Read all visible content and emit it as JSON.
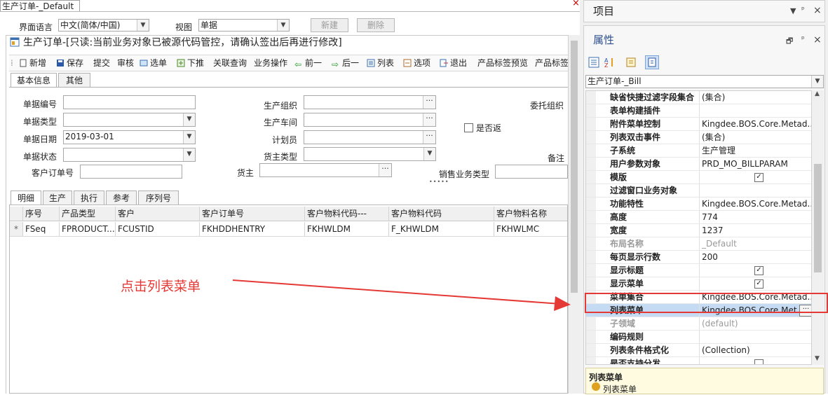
{
  "designer": {
    "doc_tab": "生产订单-_Default",
    "close_glyph": "×",
    "lang_label": "界面语言",
    "lang_value": "中文(简体/中国)",
    "view_label": "视图",
    "view_value": "单据",
    "new_label": "新建",
    "delete_label": "删除",
    "form_title": "生产订单-[只读:当前业务对象已被源代码管控，请确认签出后再进行修改]",
    "toolbar": [
      "新增",
      "保存",
      "提交",
      "审核",
      "选单",
      "下推",
      "关联查询",
      "业务操作",
      "前一",
      "后一",
      "列表",
      "选项",
      "退出",
      "产品标签预览",
      "产品标签"
    ],
    "tabs": [
      "基本信息",
      "其他"
    ],
    "fields": {
      "bill_no": "单据编号",
      "bill_type": "单据类型",
      "bill_date": "单据日期",
      "bill_date_value": "2019-03-01",
      "bill_status": "单据状态",
      "cust_order_no": "客户订单号",
      "prd_org": "生产组织",
      "workshop": "生产车间",
      "planner": "计划员",
      "owner_type": "货主类型",
      "owner": "货主",
      "entrust_org": "委托组织",
      "is_rework": "是否返",
      "remark": "备注",
      "sale_biz_type": "销售业务类型"
    },
    "dots": "•••••",
    "detail_tabs": [
      "明细",
      "生产",
      "执行",
      "参考",
      "序列号"
    ],
    "grid_headers": [
      "序号",
      "产品类型",
      "客户",
      "客户订单号",
      "客户物料代码---",
      "客户物料代码",
      "客户物料名称"
    ],
    "grid_row": [
      "FSeq",
      "FPRODUCT...",
      "FCUSTID",
      "FKHDDHENTRY",
      "FKHWLDM",
      "F_KHWLDM",
      "FKHWLMC"
    ],
    "row_marker": "*",
    "annotation": "点击列表菜单"
  },
  "project_pane": {
    "title": "项目",
    "controls": [
      "▼",
      "ᵖ",
      "×"
    ]
  },
  "property_pane": {
    "title": "属性",
    "controls": [
      "🗗",
      "ᵖ",
      "×"
    ],
    "object": "生产订单-_Bill",
    "rows": [
      {
        "name": "缺省快捷过滤字段集合",
        "value": "(集合)"
      },
      {
        "name": "表单构建插件",
        "value": ""
      },
      {
        "name": "附件菜单控制",
        "value": "Kingdee.BOS.Core.Metad..."
      },
      {
        "name": "列表双击事件",
        "value": "(集合)"
      },
      {
        "name": "子系统",
        "value": "生产管理"
      },
      {
        "name": "用户参数对象",
        "value": "PRD_MO_BILLPARAM"
      },
      {
        "name": "模版",
        "value": "✓"
      },
      {
        "name": "过滤窗口业务对象",
        "value": ""
      },
      {
        "name": "功能特性",
        "value": "Kingdee.BOS.Core.Metad..."
      },
      {
        "name": "高度",
        "value": "774"
      },
      {
        "name": "宽度",
        "value": "1237"
      },
      {
        "name": "布局名称",
        "value": "_Default"
      },
      {
        "name": "每页显示行数",
        "value": "200"
      },
      {
        "name": "显示标题",
        "value": "✓"
      },
      {
        "name": "显示菜单",
        "value": "✓"
      },
      {
        "name": "菜单集合",
        "value": "Kingdee.BOS.Core.Metad..."
      },
      {
        "name": "列表菜单",
        "value": "Kingdee.BOS.Core.Met..."
      },
      {
        "name": "子领域",
        "value": "(default)"
      },
      {
        "name": "编码规则",
        "value": ""
      },
      {
        "name": "列表条件格式化",
        "value": "(Collection)"
      },
      {
        "name": "是否支持分发",
        "value": ""
      }
    ],
    "desc_title": "列表菜单",
    "desc_text": "列表菜单"
  },
  "colors": {
    "highlight": "#e53935",
    "arrow": "#e53935",
    "selected_row": "#c5dbf3",
    "desc_bg": "#fffbe0"
  }
}
